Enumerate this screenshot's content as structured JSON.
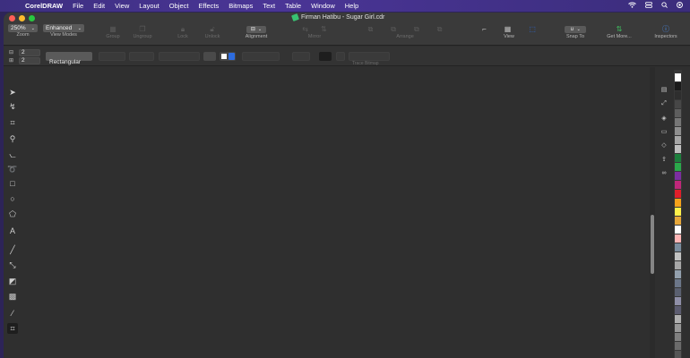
{
  "menubar": {
    "app_name": "CorelDRAW",
    "items": [
      "File",
      "Edit",
      "View",
      "Layout",
      "Object",
      "Effects",
      "Bitmaps",
      "Text",
      "Table",
      "Window",
      "Help"
    ]
  },
  "window": {
    "title": "Firman Hatibu - Sugar Girl.cdr"
  },
  "toolbar": {
    "zoom_value": "250%",
    "zoom_label": "Zoom",
    "view_mode_value": "Enhanced",
    "view_mode_label": "View Modes",
    "group_label": "Group",
    "ungroup_label": "Ungroup",
    "lock_label": "Lock",
    "unlock_label": "Unlock",
    "alignment_label": "Alignment",
    "mirror_label": "Mirror",
    "arrange_label": "Arrange",
    "view_label": "View",
    "snap_label": "Snap To",
    "get_more_label": "Get More...",
    "inspectors_label": "Inspectors"
  },
  "propbar": {
    "rows_value": "2",
    "cols_value": "2",
    "shape_value": "Rectangular",
    "trace_label": "Trace Bitmap"
  },
  "colors": {
    "accent": "#2d6cdf",
    "menubar": "#3d2f80",
    "window_bg": "#2f2f2f",
    "palette": [
      "#ffffff",
      "#1a1a1a",
      "#2e2e2e",
      "#474747",
      "#5e5e5e",
      "#767676",
      "#8e8e8e",
      "#a6a6a6",
      "#bfbfbf",
      "#1c7f3c",
      "#2aa84a",
      "#7b2ea0",
      "#c0277a",
      "#e01f2a",
      "#f6a21a",
      "#fff14a",
      "#e7a83a",
      "#ffffff",
      "#ffb6b6",
      "#7b8d9e",
      "#c2c2c2",
      "#a7a7a7",
      "#93a0ae",
      "#6c778a",
      "#5a6070",
      "#8f8fa8",
      "#5c5c70",
      "#b0b0b0",
      "#989898",
      "#808080",
      "#6b6b6b",
      "#555555"
    ]
  }
}
